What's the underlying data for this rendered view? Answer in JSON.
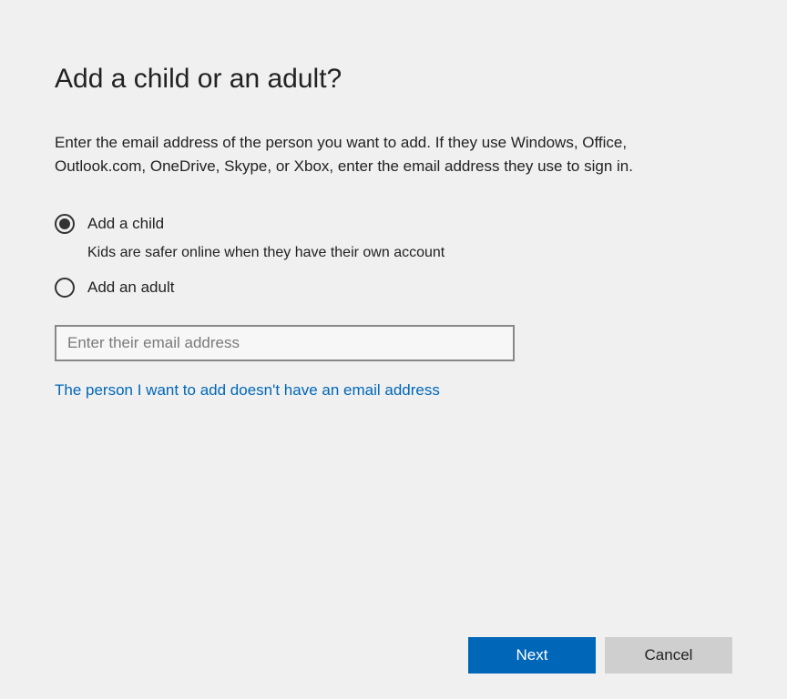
{
  "title": "Add a child or an adult?",
  "description": "Enter the email address of the person you want to add. If they use Windows, Office, Outlook.com, OneDrive, Skype, or Xbox, enter the email address they use to sign in.",
  "options": {
    "child": {
      "label": "Add a child",
      "subtext": "Kids are safer online when they have their own account",
      "selected": true
    },
    "adult": {
      "label": "Add an adult",
      "selected": false
    }
  },
  "email": {
    "placeholder": "Enter their email address",
    "value": ""
  },
  "no_email_link": "The person I want to add doesn't have an email address",
  "buttons": {
    "next": "Next",
    "cancel": "Cancel"
  }
}
